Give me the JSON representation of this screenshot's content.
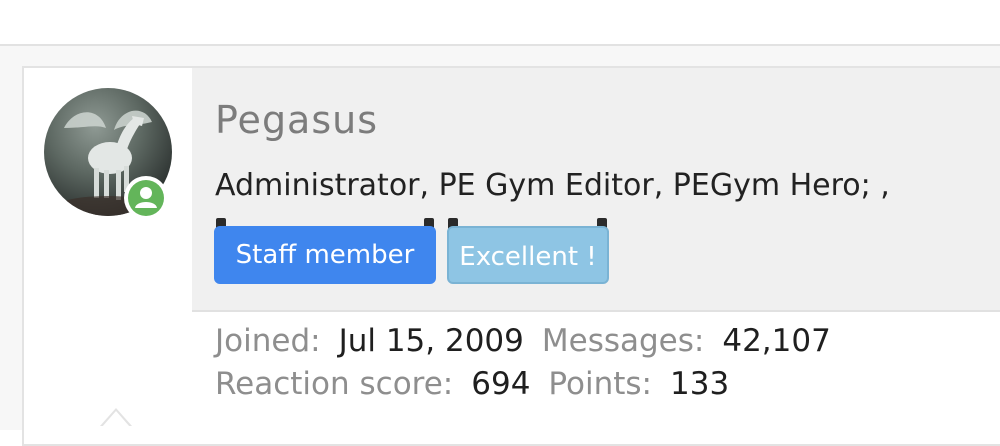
{
  "profile": {
    "username": "Pegasus",
    "user_title": "Administrator, PE Gym Editor, PEGym Hero; ,",
    "status": "online",
    "status_color": "#63b55a",
    "banners": [
      {
        "label": "Staff member",
        "color": "#3f86ee"
      },
      {
        "label": "Excellent !",
        "color": "#8ec5e4"
      }
    ],
    "stats": {
      "joined_label": "Joined:",
      "joined_value": "Jul 15, 2009",
      "messages_label": "Messages:",
      "messages_value": "42,107",
      "reaction_label": "Reaction score:",
      "reaction_value": "694",
      "points_label": "Points:",
      "points_value": "133"
    }
  },
  "icons": {
    "status": "user-icon",
    "avatar": "pegasus-avatar"
  }
}
